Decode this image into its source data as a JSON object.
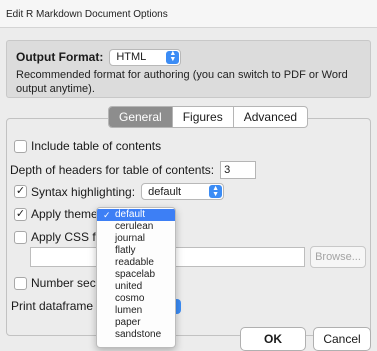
{
  "window": {
    "title": "Edit R Markdown Document Options"
  },
  "output_format": {
    "label": "Output Format:",
    "value": "HTML",
    "description": "Recommended format for authoring (you can switch to PDF or Word output anytime)."
  },
  "tabs": [
    {
      "label": "General",
      "active": true
    },
    {
      "label": "Figures",
      "active": false
    },
    {
      "label": "Advanced",
      "active": false
    }
  ],
  "general": {
    "toc_label": "Include table of contents",
    "toc_checked": false,
    "depth_label": "Depth of headers for table of contents:",
    "depth_value": "3",
    "syntax_label": "Syntax highlighting:",
    "syntax_checked": true,
    "syntax_value": "default",
    "theme_label": "Apply theme",
    "theme_checked": true,
    "css_label": "Apply CSS fi",
    "css_checked": false,
    "browse_label": "Browse...",
    "number_label": "Number sec",
    "number_checked": false,
    "print_df_label": "Print dataframe"
  },
  "theme_dropdown": {
    "selected": "default",
    "options": [
      "default",
      "cerulean",
      "journal",
      "flatly",
      "readable",
      "spacelab",
      "united",
      "cosmo",
      "lumen",
      "paper",
      "sandstone"
    ]
  },
  "buttons": {
    "ok": "OK",
    "cancel": "Cancel"
  },
  "colors": {
    "accent": "#3b8cf5",
    "selection": "#3d7ff5",
    "active_tab": "#8d8d8d"
  }
}
